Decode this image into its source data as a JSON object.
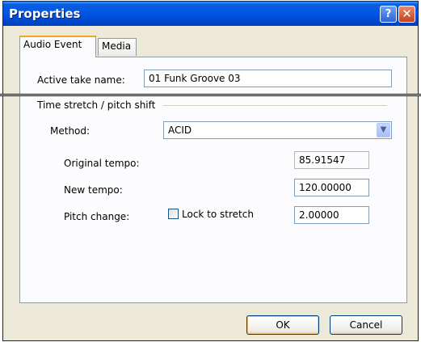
{
  "window": {
    "title": "Properties"
  },
  "titlebar": {
    "help_glyph": "?",
    "close_glyph": "✕"
  },
  "tabs": [
    {
      "label": "Audio Event",
      "active": true
    },
    {
      "label": "Media",
      "active": false
    }
  ],
  "active_take": {
    "label": "Active take name:",
    "value": "01 Funk Groove 03"
  },
  "group": {
    "title": "Time stretch / pitch shift",
    "method": {
      "label": "Method:",
      "value": "ACID"
    },
    "original_tempo": {
      "label": "Original tempo:",
      "value": "85.91547"
    },
    "new_tempo": {
      "label": "New tempo:",
      "value": "120.00000"
    },
    "pitch_change": {
      "label": "Pitch change:",
      "value": "2.00000"
    },
    "lock_to_stretch": {
      "label": "Lock to stretch",
      "checked": false
    }
  },
  "buttons": {
    "ok": "OK",
    "cancel": "Cancel"
  }
}
